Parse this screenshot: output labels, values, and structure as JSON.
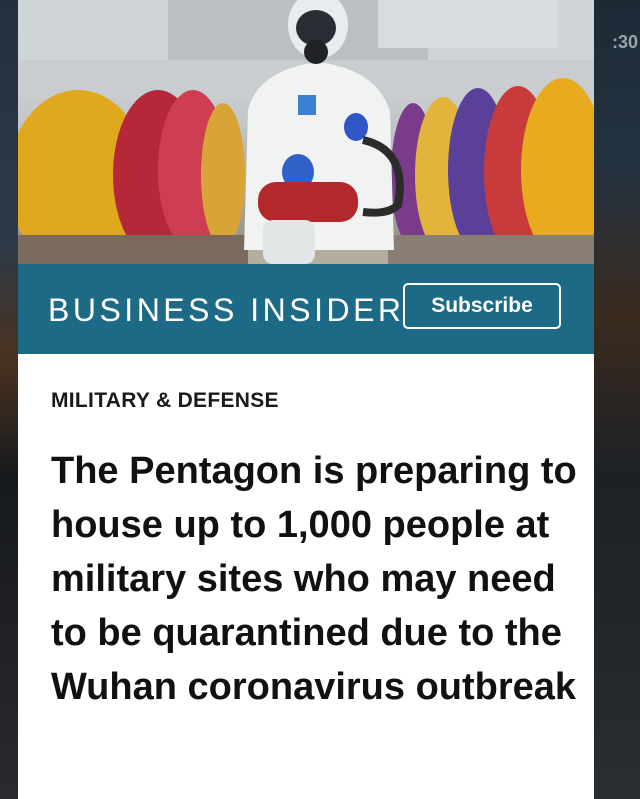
{
  "background": {
    "clock_fragment": ":30"
  },
  "masthead": {
    "brand": "BUSINESS INSIDER",
    "subscribe_label": "Subscribe",
    "color": "#1d6a86"
  },
  "article": {
    "category": "MILITARY & DEFENSE",
    "headline": "The Pentagon is preparing to house up to 1,000 people at military sites who may need to be quarantined due to the Wuhan coronavirus outbreak"
  }
}
